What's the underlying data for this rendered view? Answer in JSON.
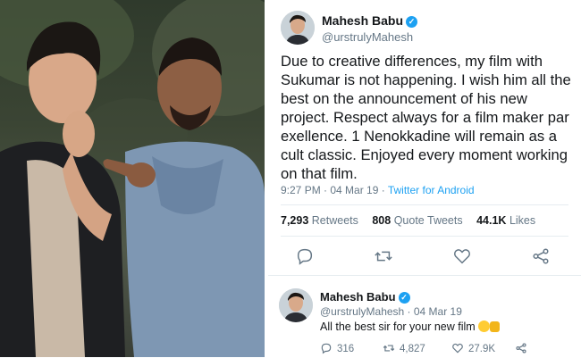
{
  "photo": {
    "alt_subjects": [
      "Mahesh Babu",
      "Sukumar"
    ]
  },
  "tweet_main": {
    "name": "Mahesh Babu",
    "handle": "@urstrulyMahesh",
    "text": "Due to creative differences, my film with Sukumar is not happening. I wish him all the best on the announcement of his new project. Respect always for a film maker par exellence. 1 Nenokkadine will remain as a cult classic. Enjoyed every moment working on that film.",
    "time": "9:27 PM · 04 Mar 19 · ",
    "source": "Twitter for Android",
    "retweets_count": "7,293",
    "retweets_label": "Retweets",
    "quotes_count": "808",
    "quotes_label": "Quote Tweets",
    "likes_count": "44.1K",
    "likes_label": "Likes"
  },
  "tweet_reply": {
    "name": "Mahesh Babu",
    "handle": "@urstrulyMahesh · 04 Mar 19",
    "text": "All the best sir for your new film",
    "replies": "316",
    "retweets": "4,827",
    "likes": "27.9K"
  },
  "colors": {
    "accent": "#1da1f2",
    "text": "#14171a",
    "muted": "#657786"
  }
}
